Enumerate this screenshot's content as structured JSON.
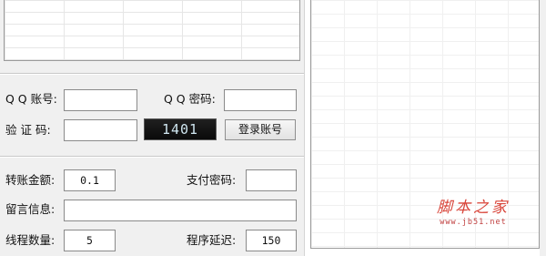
{
  "login": {
    "qq_account_label": "Q Q 账号:",
    "qq_account_value": "",
    "qq_password_label": "Q Q 密码:",
    "qq_password_value": "",
    "captcha_label": "验 证 码:",
    "captcha_value": "",
    "captcha_image_text": "1401",
    "login_button": "登录账号"
  },
  "transfer": {
    "amount_label": "转账金额:",
    "amount_value": "0.1",
    "pay_password_label": "支付密码:",
    "pay_password_value": "",
    "message_label": "留言信息:",
    "message_value": "",
    "threads_label": "线程数量:",
    "threads_value": "5",
    "delay_label": "程序延迟:",
    "delay_value": "150"
  },
  "watermark": {
    "main": "脚本之家",
    "sub": "www.jb51.net"
  },
  "colors": {
    "watermark": "#d9453a",
    "panel_bg": "#f0f0f0"
  }
}
